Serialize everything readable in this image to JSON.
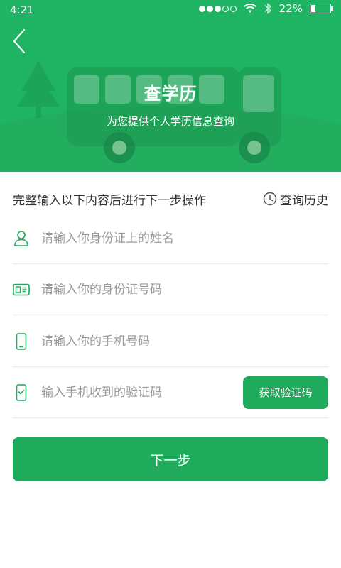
{
  "status_bar": {
    "time": "4:21",
    "battery_text": "22%",
    "battery_level": 0.22
  },
  "header": {
    "title": "查学历",
    "subtitle": "为您提供个人学历信息查询",
    "background_color": "#1fb463",
    "back_icon": "chevron-left-icon"
  },
  "form": {
    "instruction": "完整输入以下内容后进行下一步操作",
    "history_label": "查询历史",
    "history_icon": "clock-icon",
    "fields": {
      "name": {
        "placeholder": "请输入你身份证上的姓名",
        "icon": "person-icon"
      },
      "id_number": {
        "placeholder": "请输入你的身份证号码",
        "icon": "id-card-icon"
      },
      "phone": {
        "placeholder": "请输入你的手机号码",
        "icon": "phone-icon"
      },
      "code": {
        "placeholder": "输入手机收到的验证码",
        "icon": "phone-check-icon"
      }
    },
    "get_code_label": "获取验证码",
    "next_label": "下一步"
  },
  "colors": {
    "accent": "#1faa5c",
    "icon": "#1faa5c"
  }
}
